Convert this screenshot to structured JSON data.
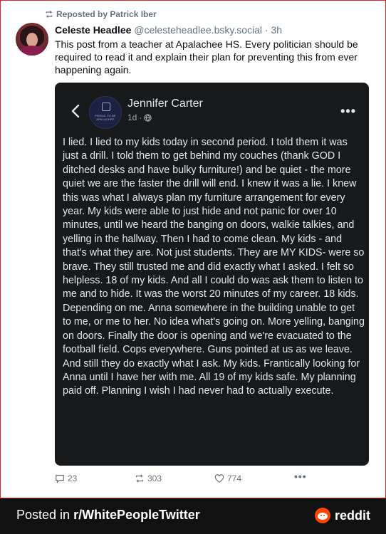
{
  "repost": {
    "label": "Reposted by Patrick Iber"
  },
  "post": {
    "author_name": "Celeste Headlee",
    "author_handle": "@celesteheadlee.bsky.social",
    "time": "3h",
    "text": "This post from a teacher at Apalachee HS. Every politician should be required to read it and explain their plan for preventing this from ever happening again."
  },
  "embedded": {
    "name": "Jennifer Carter",
    "time": "1d",
    "page_logo_text": "PROUD TO BE APALACHEE",
    "body": "I lied. I lied to my kids today in second period. I told them it was just a drill. I told them to get behind my couches (thank GOD I ditched desks and have bulky furniture!) and be quiet - the more quiet we are the faster the drill will end. I knew it was a lie. I knew this was what I always plan my furniture arrangement for every year. My kids were able to just hide and not panic for over 10 minutes, until we heard the banging on doors, walkie talkies, and yelling in the hallway. Then I had to come clean. My kids - and that's what they are. Not just students. They are MY KIDS- were so brave. They still trusted me and did exactly what I asked. I felt so helpless. 18 of my kids. And all I could do was ask them to listen to me and to hide. It was the worst 20 minutes of my career. 18 kids. Depending on me. Anna somewhere in the building unable to get to me, or me to her. No idea what's going on. More yelling, banging on doors. Finally the door is opening and we're evacuated to the football field. Cops everywhere. Guns pointed at us as we leave. And still they do exactly what I ask. My kids. Frantically looking for Anna until I have her with me. All 19 of my kids safe. My planning paid off. Planning I wish I had never had to actually execute."
  },
  "actions": {
    "replies": "23",
    "reposts": "303",
    "likes": "774"
  },
  "footer": {
    "posted_prefix": "Posted in ",
    "subreddit": "r/WhitePeopleTwitter",
    "brand": "reddit"
  },
  "colors": {
    "frame_border": "#e02424",
    "card_bg": "#18191b",
    "footer_bg": "#111111",
    "reddit_orange": "#ff4500",
    "muted": "#66727f"
  }
}
